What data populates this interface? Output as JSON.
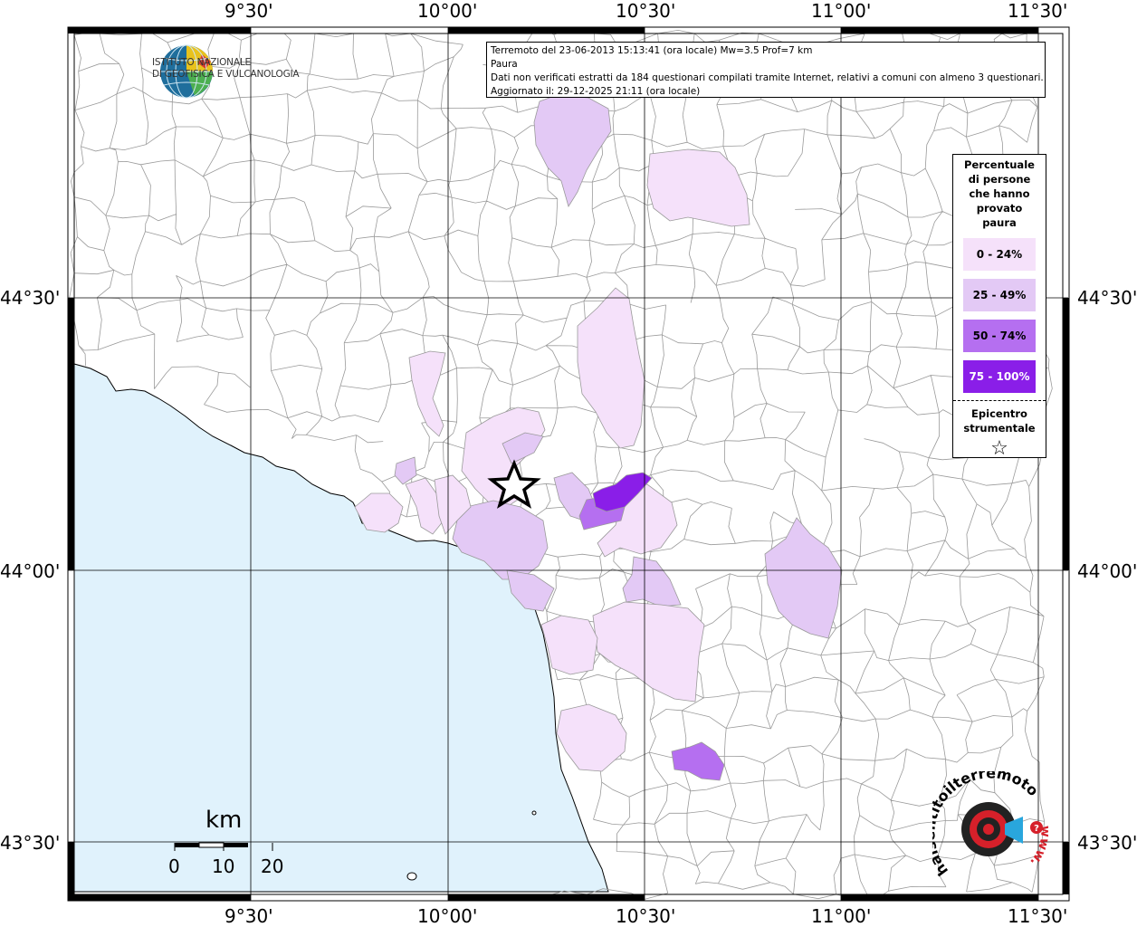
{
  "map": {
    "x_ticks": [
      "9°30'",
      "10°00'",
      "10°30'",
      "11°00'",
      "11°30'"
    ],
    "y_ticks": [
      "44°30'",
      "44°00'",
      "43°30'"
    ]
  },
  "info_box": {
    "line1": "Terremoto del 23-06-2013 15:13:41 (ora locale) Mw=3.5 Prof=7 km",
    "line2": "Paura",
    "line3": "Dati non verificati estratti da 184 questionari compilati tramite Internet, relativi a comuni con almeno 3 questionari.",
    "line4": "Aggiornato il: 29-12-2025 21:11 (ora locale)"
  },
  "logo": {
    "line1": "ISTITUTO NAZIONALE",
    "line2": "DI GEOFISICA E VULCANOLOGIA"
  },
  "legend": {
    "title_lines": [
      "Percentuale",
      "di persone",
      "che hanno",
      "provato",
      "paura"
    ],
    "classes": [
      {
        "label": "0 - 24%",
        "color": "#f5e1fa",
        "text_color": "#000000"
      },
      {
        "label": "25 - 49%",
        "color": "#e3c9f5",
        "text_color": "#000000"
      },
      {
        "label": "50 - 74%",
        "color": "#b56ff0",
        "text_color": "#000000"
      },
      {
        "label": "75 - 100%",
        "color": "#8a1ee8",
        "text_color": "#ffffff"
      }
    ],
    "epicenter_lines": [
      "Epicentro",
      "strumentale"
    ],
    "epicenter_symbol": "☆"
  },
  "scale_bar": {
    "unit": "km",
    "labels": [
      "0",
      "10",
      "20"
    ]
  },
  "brand": {
    "text": "haisentitoilterremoto.it",
    "url_text": "www."
  },
  "colors": {
    "sea": "#e0f2fc",
    "land": "#ffffff",
    "borders": "#9a9a9a",
    "grid": "#000000"
  }
}
